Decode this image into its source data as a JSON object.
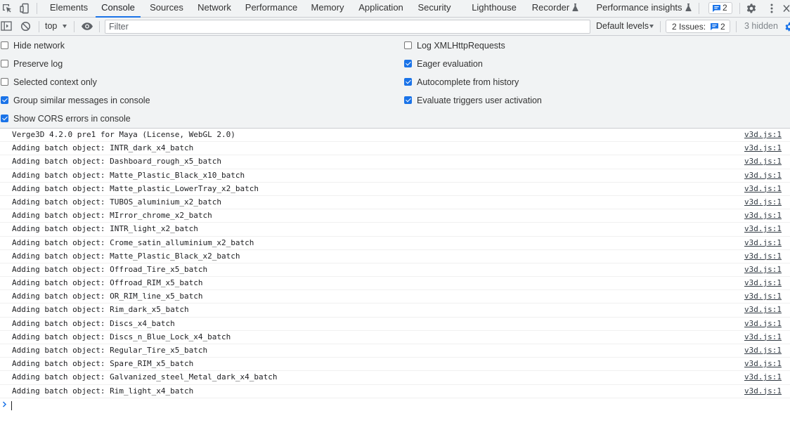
{
  "tabbar": {
    "tabs": [
      {
        "label": "Elements"
      },
      {
        "label": "Console",
        "active": true
      },
      {
        "label": "Sources"
      },
      {
        "label": "Network"
      },
      {
        "label": "Performance"
      },
      {
        "label": "Memory"
      },
      {
        "label": "Application"
      },
      {
        "label": "Security"
      },
      {
        "label": "Lighthouse"
      },
      {
        "label": "Recorder"
      },
      {
        "label": "Performance insights"
      }
    ],
    "issues_badge_count": "2",
    "icons": [
      "inspect-element-icon",
      "device-toolbar-icon",
      "flask-icon",
      "message-icon",
      "gear-icon",
      "more-vertical-icon",
      "close-icon"
    ]
  },
  "toolbar": {
    "context": "top",
    "filter_placeholder": "Filter",
    "filter_value": "",
    "levels": "Default levels",
    "issues_label": "2 Issues:",
    "issues_count": "2",
    "hidden": "3 hidden",
    "icons": [
      "sidebar-toggle-icon",
      "clear-console-icon",
      "eye-icon",
      "settings-gear-icon"
    ]
  },
  "settings": {
    "left": [
      {
        "label": "Hide network",
        "checked": false
      },
      {
        "label": "Preserve log",
        "checked": false
      },
      {
        "label": "Selected context only",
        "checked": false
      },
      {
        "label": "Group similar messages in console",
        "checked": true
      },
      {
        "label": "Show CORS errors in console",
        "checked": true
      }
    ],
    "right": [
      {
        "label": "Log XMLHttpRequests",
        "checked": false
      },
      {
        "label": "Eager evaluation",
        "checked": true
      },
      {
        "label": "Autocomplete from history",
        "checked": true
      },
      {
        "label": "Evaluate triggers user activation",
        "checked": true
      }
    ]
  },
  "messages": [
    {
      "text": "Verge3D 4.2.0 pre1 for Maya (License, WebGL 2.0)",
      "source": "v3d.js:1"
    },
    {
      "text": "Adding batch object: INTR_dark_x4_batch",
      "source": "v3d.js:1"
    },
    {
      "text": "Adding batch object: Dashboard_rough_x5_batch",
      "source": "v3d.js:1"
    },
    {
      "text": "Adding batch object: Matte_Plastic_Black_x10_batch",
      "source": "v3d.js:1"
    },
    {
      "text": "Adding batch object: Matte_plastic_LowerTray_x2_batch",
      "source": "v3d.js:1"
    },
    {
      "text": "Adding batch object: TUBOS_aluminium_x2_batch",
      "source": "v3d.js:1"
    },
    {
      "text": "Adding batch object: MIrror_chrome_x2_batch",
      "source": "v3d.js:1"
    },
    {
      "text": "Adding batch object: INTR_light_x2_batch",
      "source": "v3d.js:1"
    },
    {
      "text": "Adding batch object: Crome_satin_alluminium_x2_batch",
      "source": "v3d.js:1"
    },
    {
      "text": "Adding batch object: Matte_Plastic_Black_x2_batch",
      "source": "v3d.js:1"
    },
    {
      "text": "Adding batch object: Offroad_Tire_x5_batch",
      "source": "v3d.js:1"
    },
    {
      "text": "Adding batch object: Offroad_RIM_x5_batch",
      "source": "v3d.js:1"
    },
    {
      "text": "Adding batch object: OR_RIM_line_x5_batch",
      "source": "v3d.js:1"
    },
    {
      "text": "Adding batch object: Rim_dark_x5_batch",
      "source": "v3d.js:1"
    },
    {
      "text": "Adding batch object: Discs_x4_batch",
      "source": "v3d.js:1"
    },
    {
      "text": "Adding batch object: Discs_n_Blue_Lock_x4_batch",
      "source": "v3d.js:1"
    },
    {
      "text": "Adding batch object: Regular_Tire_x5_batch",
      "source": "v3d.js:1"
    },
    {
      "text": "Adding batch object: Spare_RIM_x5_batch",
      "source": "v3d.js:1"
    },
    {
      "text": "Adding batch object: Galvanized_steel_Metal_dark_x4_batch",
      "source": "v3d.js:1"
    },
    {
      "text": "Adding batch object: Rim_light_x4_batch",
      "source": "v3d.js:1"
    }
  ],
  "colors": {
    "accent": "#1a73e8",
    "toolbar_bg": "#f1f3f4",
    "border": "#cbcdd1"
  }
}
